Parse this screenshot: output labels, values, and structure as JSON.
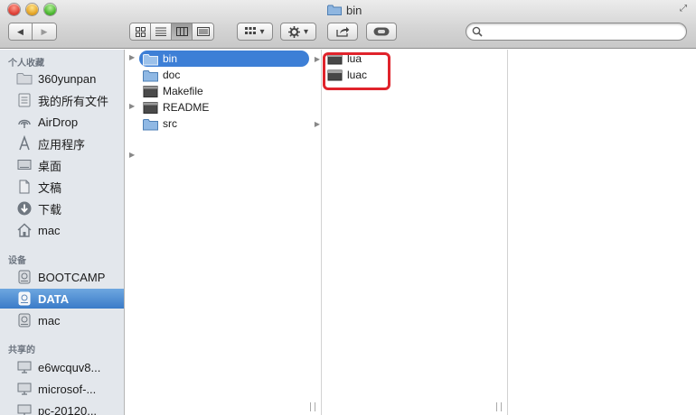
{
  "window": {
    "title": "bin"
  },
  "toolbar": {
    "back_glyph": "◀",
    "forward_glyph": "▶",
    "view_modes": [
      "icon-view",
      "list-view",
      "column-view",
      "coverflow-view"
    ],
    "arrange_glyph": "▾",
    "action_glyph": "▾"
  },
  "search": {
    "value": "",
    "placeholder": ""
  },
  "sidebar": {
    "sections": [
      {
        "title": "个人收藏",
        "items": [
          {
            "label": "360yunpan",
            "icon": "folder-icon"
          },
          {
            "label": "我的所有文件",
            "icon": "all-files-icon"
          },
          {
            "label": "AirDrop",
            "icon": "airdrop-icon"
          },
          {
            "label": "应用程序",
            "icon": "applications-icon"
          },
          {
            "label": "桌面",
            "icon": "desktop-icon"
          },
          {
            "label": "文稿",
            "icon": "documents-icon"
          },
          {
            "label": "下载",
            "icon": "downloads-icon"
          },
          {
            "label": "mac",
            "icon": "home-icon"
          }
        ]
      },
      {
        "title": "设备",
        "items": [
          {
            "label": "BOOTCAMP",
            "icon": "disk-icon"
          },
          {
            "label": "DATA",
            "icon": "disk-icon",
            "selected": true
          },
          {
            "label": "mac",
            "icon": "disk-icon"
          }
        ]
      },
      {
        "title": "共享的",
        "items": [
          {
            "label": "e6wcquv8...",
            "icon": "computer-icon"
          },
          {
            "label": "microsof-...",
            "icon": "computer-icon"
          },
          {
            "label": "pc-20120...",
            "icon": "computer-icon"
          }
        ]
      }
    ]
  },
  "columns": {
    "col1": [
      {
        "label": "bin",
        "type": "folder",
        "selected": true,
        "has_children": true
      },
      {
        "label": "doc",
        "type": "folder",
        "has_children": false
      },
      {
        "label": "Makefile",
        "type": "file",
        "has_children": false
      },
      {
        "label": "README",
        "type": "file",
        "has_children": true
      },
      {
        "label": "src",
        "type": "folder",
        "has_children": true
      }
    ],
    "col2": [
      {
        "label": "lua",
        "type": "exec"
      },
      {
        "label": "luac",
        "type": "exec"
      }
    ]
  },
  "colors": {
    "selection": "#3d7fd6",
    "highlight": "#e0232b",
    "sidebar_bg": "#e3e7ec"
  }
}
